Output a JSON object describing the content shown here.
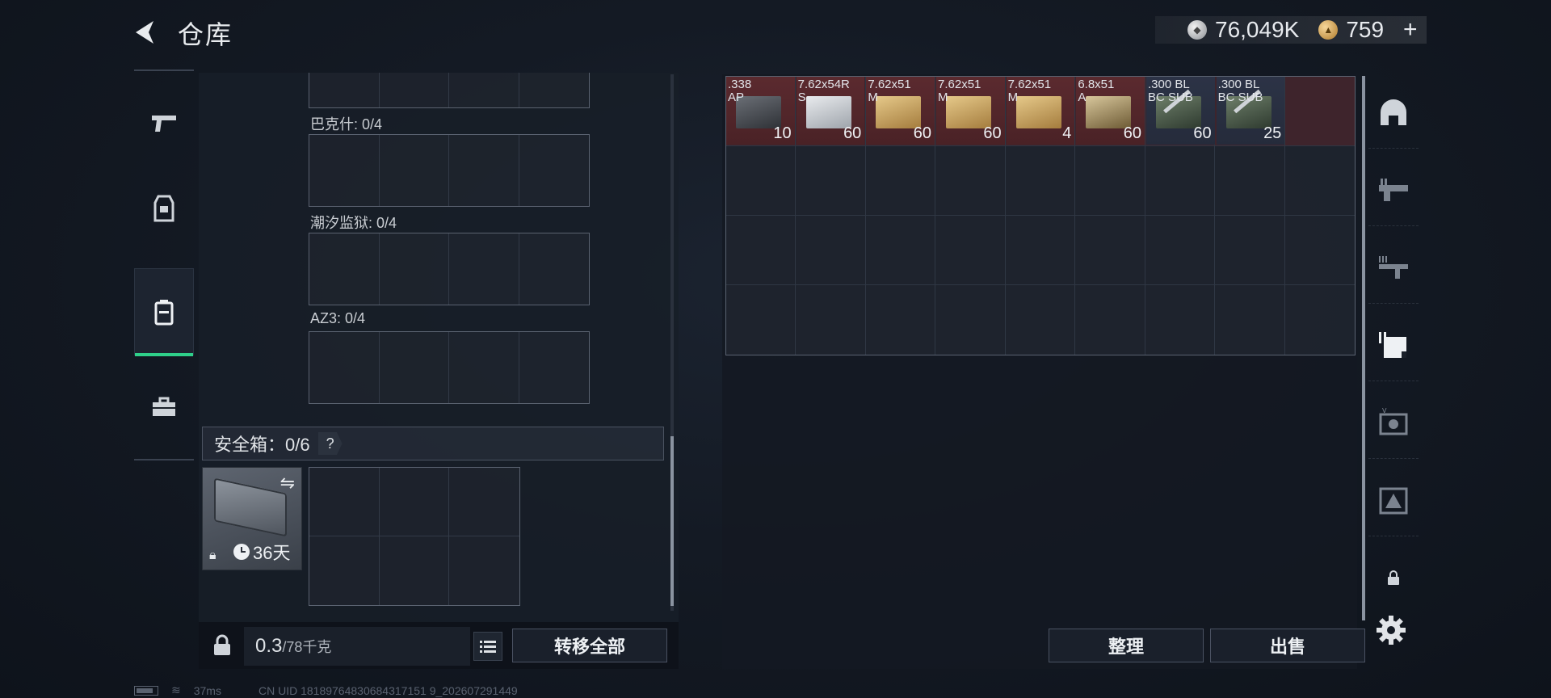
{
  "header": {
    "title": "仓库"
  },
  "currency": {
    "silver": "76,049K",
    "gold": "759",
    "plus": "+"
  },
  "left_tabs": [
    {
      "name": "weapons"
    },
    {
      "name": "equipment"
    },
    {
      "name": "backpack"
    },
    {
      "name": "briefcase"
    }
  ],
  "slots": [
    {
      "label": "巴克什: 0/4"
    },
    {
      "label": "潮汐监狱: 0/4"
    },
    {
      "label": "AZ3: 0/4"
    }
  ],
  "safe_box": {
    "title": "安全箱：0/6",
    "help": "?",
    "duration": "36天"
  },
  "weight": {
    "current": "0.3",
    "max": "/78千克"
  },
  "buttons": {
    "transfer_all": "转移全部",
    "sort": "整理",
    "sell": "出售"
  },
  "stash_items": [
    {
      "name": ".338\nAP",
      "count": "10",
      "style": "red",
      "box": "box-dark"
    },
    {
      "name": "7.62x54R\nS",
      "count": "60",
      "style": "red",
      "box": "box-white"
    },
    {
      "name": "7.62x51\nM",
      "count": "60",
      "style": "red",
      "box": "box-tan"
    },
    {
      "name": "7.62x51\nM",
      "count": "60",
      "style": "red",
      "box": "box-tan"
    },
    {
      "name": "7.62x51\nM",
      "count": "4",
      "style": "red",
      "box": "box-tan"
    },
    {
      "name": "6.8x51\nA",
      "count": "60",
      "style": "red",
      "box": "box-tan2"
    },
    {
      "name": ".300 BL\nBC SUB",
      "count": "60",
      "style": "blue",
      "box": "box-green"
    },
    {
      "name": ".300 BL\nBC SUB",
      "count": "25",
      "style": "blue",
      "box": "box-green"
    }
  ],
  "status": {
    "ping": "37ms",
    "uid": "CN UID 18189764830684317151 9_202607291449"
  },
  "colors": {
    "accent": "#2fd08a",
    "item_red": "#5b2a2f",
    "item_blue": "#2c3346"
  }
}
